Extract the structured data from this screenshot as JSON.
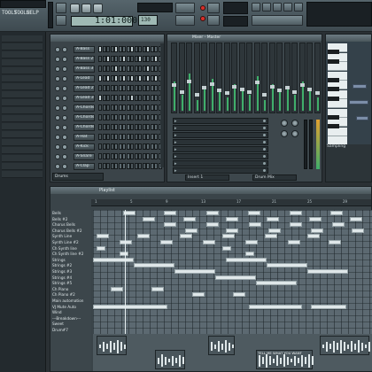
{
  "menu": {
    "items": [
      "TOOLS",
      "TOOLS",
      "HELP"
    ]
  },
  "transport": {
    "time_display": "1:01:000",
    "bpm_display": "130"
  },
  "stepseq": {
    "channels": [
      {
        "label": "A-Bass"
      },
      {
        "label": "A-Bass 2"
      },
      {
        "label": "A-Bass 3"
      },
      {
        "label": "A-Lead"
      },
      {
        "label": "A-Lead 2"
      },
      {
        "label": "A-Lead 3"
      },
      {
        "label": "A-Chords"
      },
      {
        "label": "A-Chords 2"
      },
      {
        "label": "A-Chords 3"
      },
      {
        "label": "A-Hat"
      },
      {
        "label": "A-Kick"
      },
      {
        "label": "A-Snare"
      },
      {
        "label": "A-Clap"
      }
    ],
    "footer": "Drums"
  },
  "mixer": {
    "title": "Mixer - Master",
    "insert_label": "Insert 1",
    "fx_label": "Drum Mix"
  },
  "pianoroll": {
    "footer": "Sampling"
  },
  "playlist": {
    "title": "Playlist",
    "ruler": [
      "1",
      "5",
      "9",
      "13",
      "17",
      "21",
      "25",
      "29"
    ],
    "tracks": [
      "Bells",
      "Bells #2",
      "Chorus Bells",
      "Chorus Bells #2",
      "Synth Line",
      "Synth Line #2",
      "Ch Synth line",
      "Ch Synth line #2",
      "Strings",
      "Strings #2",
      "Strings #3",
      "Strings #4",
      "Strings #5",
      "Ch Piano",
      "Ch Piano #2",
      "Main automation",
      "VJ Mute Auto",
      "Wind",
      "---Breakdown---",
      "Sweet",
      "Drum#7"
    ],
    "audio_clip_label": "TELL ME WHAT YOU WANT"
  }
}
